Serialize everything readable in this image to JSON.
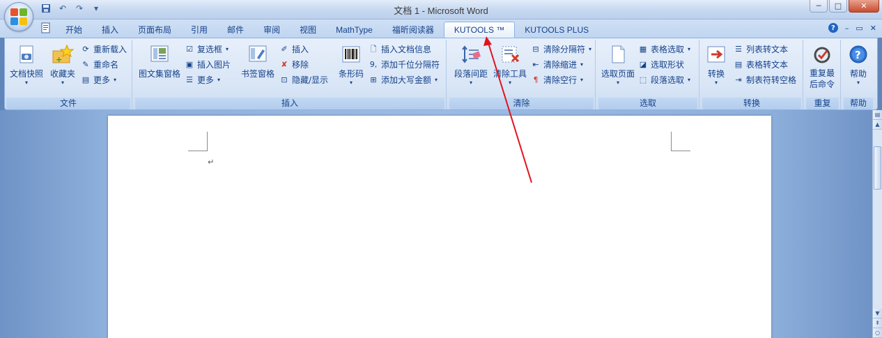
{
  "window": {
    "title": "文档 1 - Microsoft Word",
    "minimize_icon": "minimize-icon",
    "maximize_icon": "maximize-icon",
    "close_icon": "close-icon"
  },
  "qat": {
    "icons": [
      "save-icon",
      "undo-icon",
      "redo-icon",
      "customize-qat-icon"
    ]
  },
  "tabs": [
    {
      "label": "开始",
      "active": false
    },
    {
      "label": "插入",
      "active": false
    },
    {
      "label": "页面布局",
      "active": false
    },
    {
      "label": "引用",
      "active": false
    },
    {
      "label": "邮件",
      "active": false
    },
    {
      "label": "审阅",
      "active": false
    },
    {
      "label": "视图",
      "active": false
    },
    {
      "label": "MathType",
      "active": false
    },
    {
      "label": "福昕阅读器",
      "active": false
    },
    {
      "label": "KUTOOLS ™",
      "active": true
    },
    {
      "label": "KUTOOLS PLUS",
      "active": false
    }
  ],
  "ribbon": {
    "groups": {
      "file": {
        "label": "文件",
        "doc_snapshot": "文档快照",
        "favorites": "收藏夹",
        "reload": "重新载入",
        "rename": "重命名",
        "more": "更多"
      },
      "insert": {
        "label": "插入",
        "picture_pane": "图文集窗格",
        "checkbox": "复选框",
        "insert_picture": "插入图片",
        "more": "更多",
        "bookmark_pane": "书签窗格",
        "insert": "插入",
        "remove": "移除",
        "hide_show": "隐藏/显示",
        "barcode": "条形码",
        "insert_doc_info": "插入文档信息",
        "add_thousand_sep": "添加千位分隔符",
        "add_capital_amount": "添加大写金额"
      },
      "clear": {
        "label": "清除",
        "para_spacing": "段落间距",
        "clear_tools": "清除工具",
        "clear_separator": "清除分隔符",
        "clear_indent": "清除缩进",
        "clear_empty_lines": "清除空行"
      },
      "select": {
        "label": "选取",
        "select_page": "选取页面",
        "table_select": "表格选取",
        "select_shapes": "选取形状",
        "para_select": "段落选取"
      },
      "convert": {
        "label": "转换",
        "convert": "转换",
        "list_to_text": "列表转文本",
        "table_to_text": "表格转文本",
        "tab_to_space": "制表符转空格"
      },
      "repeat": {
        "label": "重复",
        "repeat_last": "重复最后命令"
      },
      "help": {
        "label": "帮助",
        "help": "帮助"
      }
    }
  },
  "document": {
    "paragraph_mark": "↵"
  },
  "colors": {
    "ribbon_text": "#15428b",
    "annotation_arrow": "#e0141e",
    "doc_background": "#9dbce4"
  }
}
